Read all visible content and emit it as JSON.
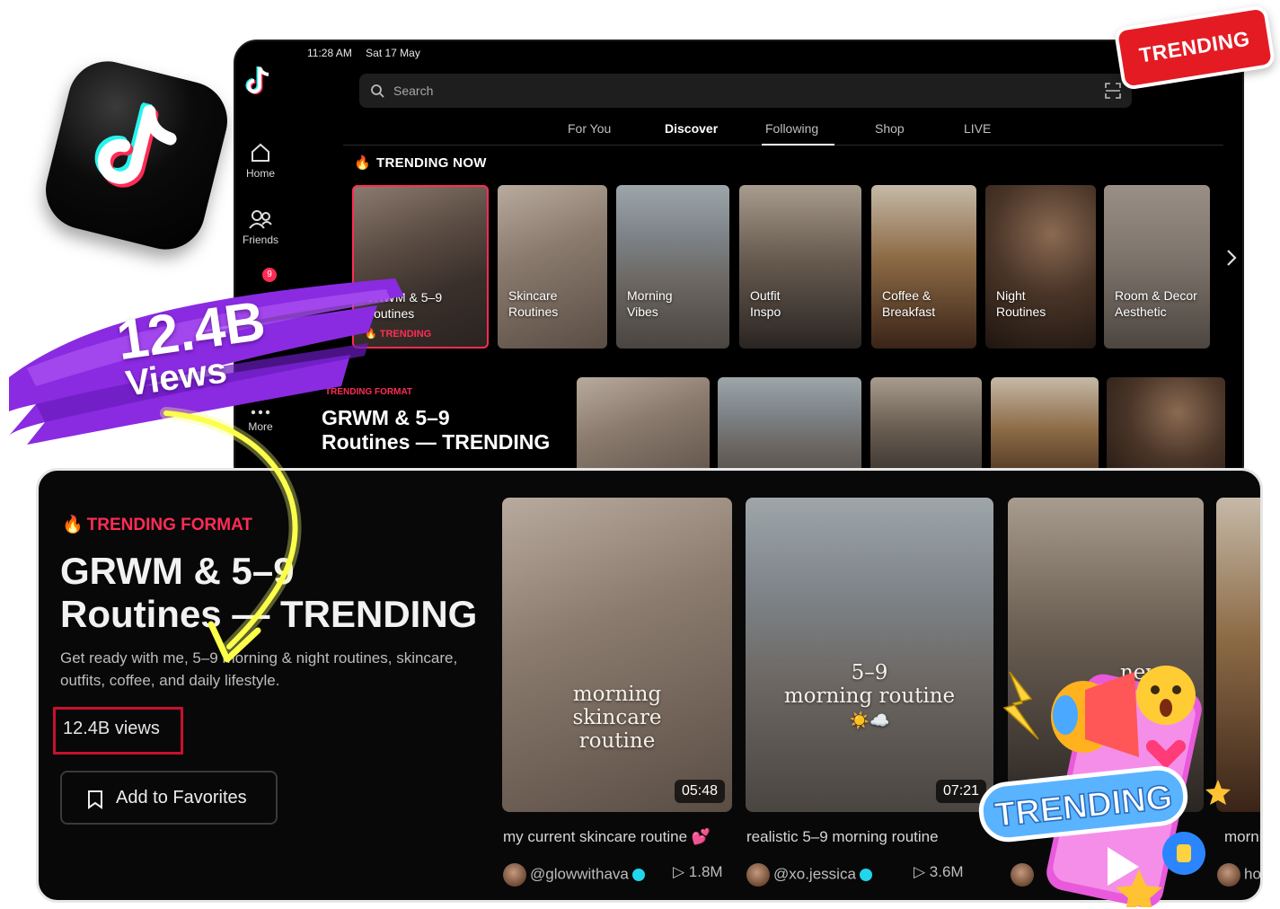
{
  "status_bar": {
    "time": "11:28 AM",
    "date": "Sat 17 May"
  },
  "sidebar": {
    "items": [
      {
        "label": "Home",
        "icon": "home-icon"
      },
      {
        "label": "Friends",
        "icon": "friends-icon"
      },
      {
        "label": "More",
        "icon": "more-icon"
      }
    ],
    "inbox_badge": "9"
  },
  "search": {
    "placeholder": "Search"
  },
  "tabs": [
    "For You",
    "Discover",
    "Following",
    "Shop",
    "LIVE"
  ],
  "active_tab": "Discover",
  "trending_now": {
    "title": "TRENDING NOW",
    "cards": [
      {
        "label_line1": "GRWM & 5–9",
        "label_line2": "Routines",
        "tag": "TRENDING",
        "selected": true
      },
      {
        "label_line1": "Skincare",
        "label_line2": "Routines"
      },
      {
        "label_line1": "Morning",
        "label_line2": "Vibes"
      },
      {
        "label_line1": "Outfit",
        "label_line2": "Inspo"
      },
      {
        "label_line1": "Coffee &",
        "label_line2": "Breakfast"
      },
      {
        "label_line1": "Night",
        "label_line2": "Routines"
      },
      {
        "label_line1": "Room & Decor",
        "label_line2": "Aesthetic"
      }
    ]
  },
  "format_preview": {
    "label": "TRENDING FORMAT",
    "title_line1": "GRWM & 5–9",
    "title_line2": "Routines — TRENDING"
  },
  "promo": {
    "views_number": "12.4B",
    "views_word": "Views",
    "sticker": "TRENDING",
    "badge_text": "TRENDING"
  },
  "detail": {
    "label": "TRENDING FORMAT",
    "title_line1": "GRWM & 5–9",
    "title_line2": "Routines — TRENDING",
    "description": "Get ready with me, 5–9 morning & night routines, skincare, outfits, coffee, and daily lifestyle.",
    "views": "12.4B views",
    "favorite_button": "Add to Favorites",
    "videos": [
      {
        "overlay1": "morning",
        "overlay2": "skincare",
        "overlay3": "routine",
        "duration": "05:48",
        "caption": "my current skincare routine 💕",
        "user": "@glowwithava",
        "plays": "1.8M"
      },
      {
        "overlay1": "5–9",
        "overlay2": "morning routine",
        "overlay3": "☀️☁️",
        "duration": "07:21",
        "caption": "realistic 5–9 morning routine",
        "user": "@xo.jessica",
        "plays": "3.6M"
      },
      {
        "overlay1": "new",
        "duration": "…6",
        "caption": "",
        "user": "",
        "plays": ""
      },
      {
        "caption": "mornin",
        "user": "ho"
      }
    ]
  },
  "colors": {
    "accent": "#fe2c55",
    "cyan": "#25f4ee",
    "purple": "#8a2be2",
    "sticker_red": "#e41b23"
  }
}
